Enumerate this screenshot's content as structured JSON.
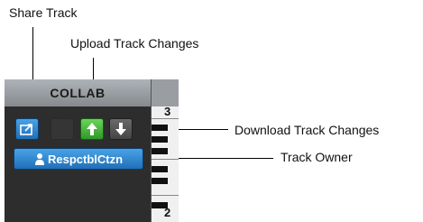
{
  "callouts": {
    "share_track": "Share Track",
    "upload_track_changes": "Upload Track Changes",
    "download_track_changes": "Download Track Changes",
    "track_owner": "Track Owner"
  },
  "panel": {
    "title": "COLLAB",
    "owner_name": "RespctblCtzn",
    "piano_numbers": [
      "3",
      "2"
    ]
  },
  "icons": {
    "share": "share-icon",
    "upload": "arrow-up-icon",
    "download": "arrow-down-icon",
    "owner": "person-icon"
  },
  "colors": {
    "share_button": "#2b86d4",
    "upload_button": "#3fae34",
    "download_button": "#555555",
    "panel_bg": "#2d2d2d"
  }
}
